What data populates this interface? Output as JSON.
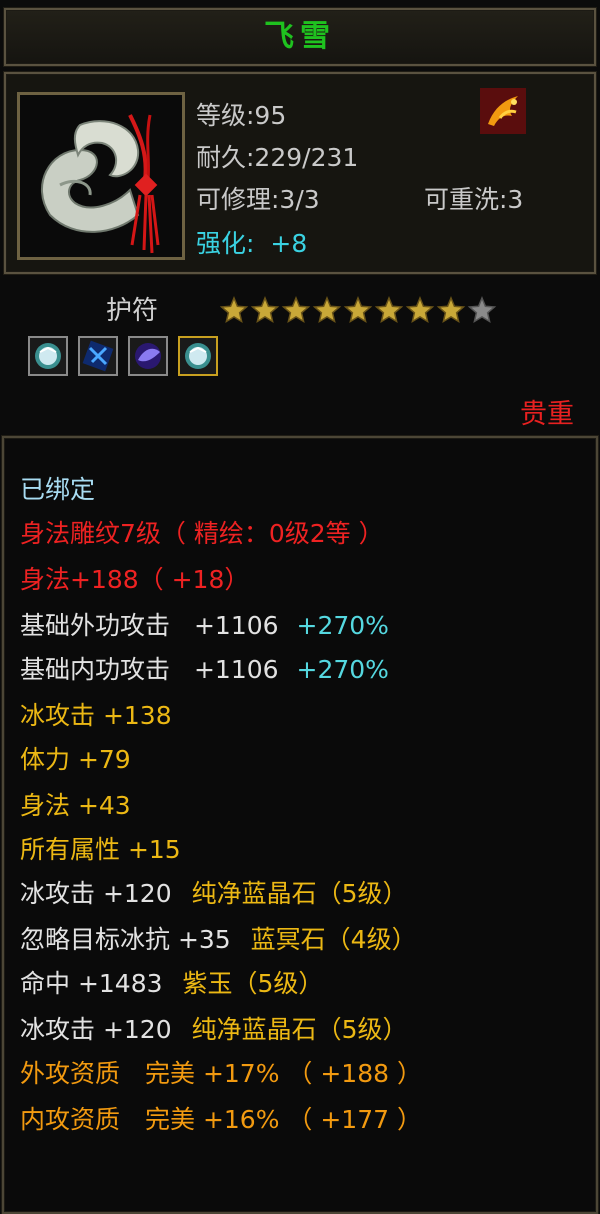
{
  "item": {
    "name": "飞雪",
    "level": "等级:95",
    "durability": "耐久:229/231",
    "repairable": "可修理:3/3",
    "rewash": "可重洗:3",
    "enhance_label": "强化:",
    "enhance_value": "+8",
    "type": "护符",
    "stars_filled": 8,
    "stars_total": 9,
    "rarity": "贵重"
  },
  "icons": {
    "item_icon": "jade-fox-tail-amulet-icon",
    "set_icon": "phoenix-emblem-icon",
    "gems": [
      "white-gem-icon",
      "blue-gem-icon",
      "purple-gem-icon",
      "white-gem-icon"
    ]
  },
  "colors": {
    "title": "#1fc21f",
    "base_attr": "#e2e2e2",
    "engraving": "#ee2222",
    "enchant": "#ecb814",
    "percent": "#55d8e0",
    "aptitude": "#f29a10",
    "bound": "#a8dcf2",
    "rarity": "#e82020"
  },
  "attributes": {
    "bound": "已绑定",
    "engraving": "身法雕纹7级（ 精绘：0级2等 ）",
    "engraving_bonus": "身法+188（ +18）",
    "base_ext_label": "基础外功攻击",
    "base_ext_value": "+1106",
    "base_ext_pct": "+270%",
    "base_int_label": "基础内功攻击",
    "base_int_value": "+1106",
    "base_int_pct": "+270%",
    "ice_attack": "冰攻击 +138",
    "stamina": "体力 +79",
    "agility": "身法 +43",
    "all_attr": "所有属性 +15",
    "gem1_label": "冰攻击 +120",
    "gem1_name": "纯净蓝晶石（5级）",
    "gem2_label": "忽略目标冰抗 +35",
    "gem2_name": "蓝冥石（4级）",
    "gem3_label": "命中 +1483",
    "gem3_name": "紫玉（5级）",
    "gem4_label": "冰攻击 +120",
    "gem4_name": "纯净蓝晶石（5级）",
    "apt_ext": "外攻资质　完美 +17% （ +188 ）",
    "apt_int": "内攻资质　完美 +16% （ +177 ）"
  }
}
